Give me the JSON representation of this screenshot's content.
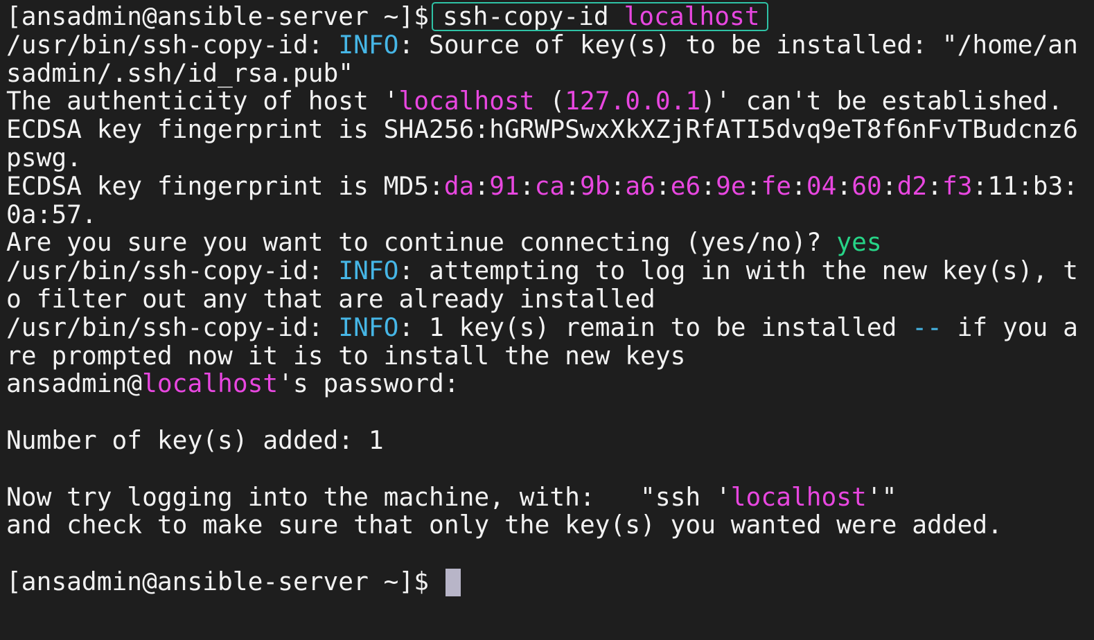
{
  "colors": {
    "background": "#1e1e1e",
    "text": "#f2f2f2",
    "info": "#46b6e6",
    "magenta": "#e847e0",
    "green": "#27d487",
    "cursor": "#b8b5c8",
    "highlight_border": "#2fc3a6"
  },
  "terminal": {
    "lines": [
      {
        "segments": [
          {
            "text": "[ansadmin@ansible-server ~]$"
          },
          {
            "text": "ssh-copy-id ",
            "box": true
          },
          {
            "text": "localhost",
            "color": "magenta",
            "box_end": true
          }
        ]
      },
      {
        "segments": [
          {
            "text": "/usr/bin/ssh-copy-id: "
          },
          {
            "text": "INFO",
            "color": "info"
          },
          {
            "text": ": Source of key(s) to be installed: \"/home/an"
          }
        ]
      },
      {
        "segments": [
          {
            "text": "sadmin/.ssh/id_rsa.pub\""
          }
        ]
      },
      {
        "segments": [
          {
            "text": "The authenticity of host '"
          },
          {
            "text": "localhost",
            "color": "magenta"
          },
          {
            "text": " ("
          },
          {
            "text": "127.0.0.1",
            "color": "magenta"
          },
          {
            "text": ")' can't be established."
          }
        ]
      },
      {
        "segments": [
          {
            "text": "ECDSA key fingerprint is SHA256:hGRWPSwxXkXZjRfATI5dvq9eT8f6nFvTBudcnz6"
          }
        ]
      },
      {
        "segments": [
          {
            "text": "pswg."
          }
        ]
      },
      {
        "segments": [
          {
            "text": "ECDSA key fingerprint is MD5:"
          },
          {
            "text": "da",
            "color": "magenta"
          },
          {
            "text": ":"
          },
          {
            "text": "91",
            "color": "magenta"
          },
          {
            "text": ":"
          },
          {
            "text": "ca",
            "color": "magenta"
          },
          {
            "text": ":"
          },
          {
            "text": "9b",
            "color": "magenta"
          },
          {
            "text": ":"
          },
          {
            "text": "a6",
            "color": "magenta"
          },
          {
            "text": ":"
          },
          {
            "text": "e6",
            "color": "magenta"
          },
          {
            "text": ":"
          },
          {
            "text": "9e",
            "color": "magenta"
          },
          {
            "text": ":"
          },
          {
            "text": "fe",
            "color": "magenta"
          },
          {
            "text": ":"
          },
          {
            "text": "04",
            "color": "magenta"
          },
          {
            "text": ":"
          },
          {
            "text": "60",
            "color": "magenta"
          },
          {
            "text": ":"
          },
          {
            "text": "d2",
            "color": "magenta"
          },
          {
            "text": ":"
          },
          {
            "text": "f3",
            "color": "magenta"
          },
          {
            "text": ":11:b3:"
          }
        ]
      },
      {
        "segments": [
          {
            "text": "0a:57."
          }
        ]
      },
      {
        "segments": [
          {
            "text": "Are you sure you want to continue connecting (yes/no)? "
          },
          {
            "text": "yes",
            "color": "green"
          }
        ]
      },
      {
        "segments": [
          {
            "text": "/usr/bin/ssh-copy-id: "
          },
          {
            "text": "INFO",
            "color": "info"
          },
          {
            "text": ": attempting to log in with the new key(s), t"
          }
        ]
      },
      {
        "segments": [
          {
            "text": "o filter out any that are already installed"
          }
        ]
      },
      {
        "segments": [
          {
            "text": "/usr/bin/ssh-copy-id: "
          },
          {
            "text": "INFO",
            "color": "info"
          },
          {
            "text": ": 1 key(s) remain to be installed "
          },
          {
            "text": "--",
            "color": "info"
          },
          {
            "text": " if you a"
          }
        ]
      },
      {
        "segments": [
          {
            "text": "re prompted now it is to install the new keys"
          }
        ]
      },
      {
        "segments": [
          {
            "text": "ansadmin@"
          },
          {
            "text": "localhost",
            "color": "magenta"
          },
          {
            "text": "'s password:"
          }
        ]
      },
      {
        "segments": []
      },
      {
        "segments": [
          {
            "text": "Number of key(s) added: 1"
          }
        ]
      },
      {
        "segments": []
      },
      {
        "segments": [
          {
            "text": "Now try logging into the machine, with:   \"ssh '"
          },
          {
            "text": "localhost",
            "color": "magenta"
          },
          {
            "text": "'\""
          }
        ]
      },
      {
        "segments": [
          {
            "text": "and check to make sure that only the key(s) you wanted were added."
          }
        ]
      },
      {
        "segments": []
      },
      {
        "segments": [
          {
            "text": "[ansadmin@ansible-server ~]$ "
          }
        ],
        "cursor": true
      }
    ]
  }
}
